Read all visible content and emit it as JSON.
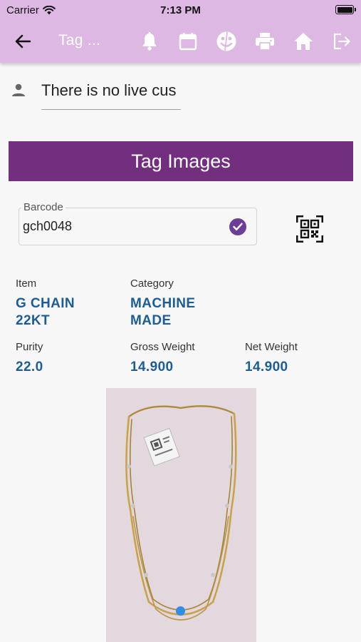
{
  "status_bar": {
    "carrier": "Carrier",
    "time": "7:13 PM"
  },
  "app_bar": {
    "title": "Tag ...",
    "icons": [
      "back-arrow-icon",
      "bell-icon",
      "calendar-icon",
      "face-icon",
      "printer-icon",
      "home-icon",
      "logout-icon"
    ]
  },
  "customer": {
    "value": "There is no live cus"
  },
  "banner": {
    "title": "Tag Images"
  },
  "barcode": {
    "label": "Barcode",
    "value": "gch0048"
  },
  "details": {
    "item_label": "Item",
    "item_value_line1": "G CHAIN",
    "item_value_line2": "22KT",
    "category_label": "Category",
    "category_value_line1": "MACHINE",
    "category_value_line2": "MADE",
    "purity_label": "Purity",
    "purity_value": "22.0",
    "gross_label": "Gross Weight",
    "gross_value": "14.900",
    "net_label": "Net Weight",
    "net_value": "14.900"
  },
  "colors": {
    "app_bar": "#dcb8e2",
    "banner": "#722f7f",
    "value_text": "#1c5d96",
    "check": "#6c3f96",
    "page_indicator": "#2f8fe8"
  }
}
